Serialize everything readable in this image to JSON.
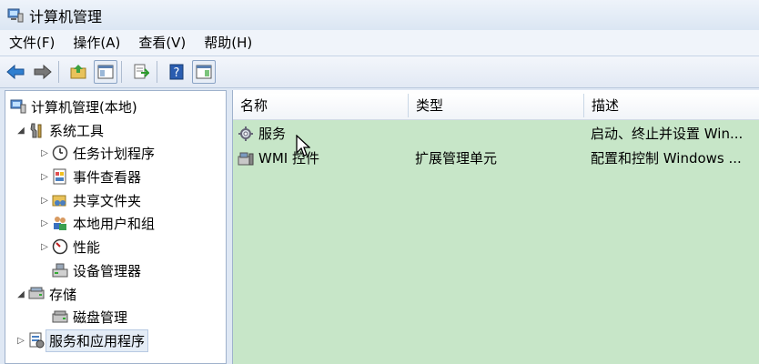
{
  "window": {
    "title": "计算机管理",
    "icon": "computer-management-icon"
  },
  "menu": [
    "文件(F)",
    "操作(A)",
    "查看(V)",
    "帮助(H)"
  ],
  "toolbar": {
    "buttons": [
      "back-arrow-icon",
      "forward-arrow-icon",
      "up-folder-icon",
      "show-hide-tree-icon",
      "export-list-icon",
      "help-icon",
      "show-action-pane-icon"
    ]
  },
  "tree": {
    "root": "计算机管理(本地)",
    "system_tools": "系统工具",
    "task_scheduler": "任务计划程序",
    "event_viewer": "事件查看器",
    "shared_folders": "共享文件夹",
    "local_users": "本地用户和组",
    "performance": "性能",
    "device_manager": "设备管理器",
    "storage": "存储",
    "disk_management": "磁盘管理",
    "services_apps": "服务和应用程序"
  },
  "table": {
    "columns": {
      "name": "名称",
      "type": "类型",
      "desc": "描述"
    },
    "rows": [
      {
        "name": "服务",
        "type": "",
        "desc": "启动、终止并设置 Win..."
      },
      {
        "name": "WMI 控件",
        "type": "扩展管理单元",
        "desc": "配置和控制 Windows ..."
      }
    ]
  },
  "colors": {
    "list_bg": "#c7e6c8",
    "chrome_bg": "#dfe8f4"
  }
}
